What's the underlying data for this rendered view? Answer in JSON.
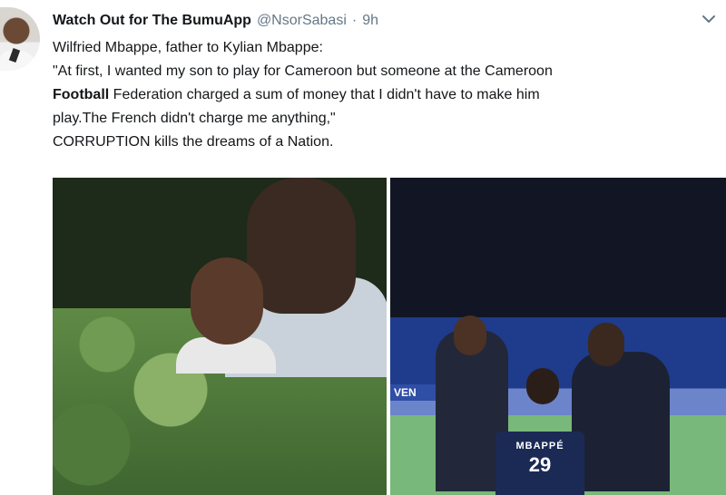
{
  "tweet": {
    "display_name": "Watch Out for The BumuApp",
    "handle": "@NsorSabasi",
    "separator": "·",
    "time": "9h",
    "lines": {
      "line1": "Wilfried Mbappe, father to Kylian Mbappe:",
      "line2": "\"At first, I wanted my son to play for Cameroon but someone at the Cameroon",
      "line3_bold": "Football",
      "line3_rest": " Federation charged a sum of money that I didn't have to make him",
      "line4": "play.The French didn't charge me anything,\"",
      "line5": "CORRUPTION kills the dreams of a Nation."
    },
    "media": {
      "image2_banner": "VEN",
      "jersey_name": "MBAPPÉ",
      "jersey_number": "29"
    }
  },
  "icons": {
    "more": "chevron-down-icon"
  },
  "colors": {
    "text": "#14171a",
    "muted": "#657786"
  }
}
